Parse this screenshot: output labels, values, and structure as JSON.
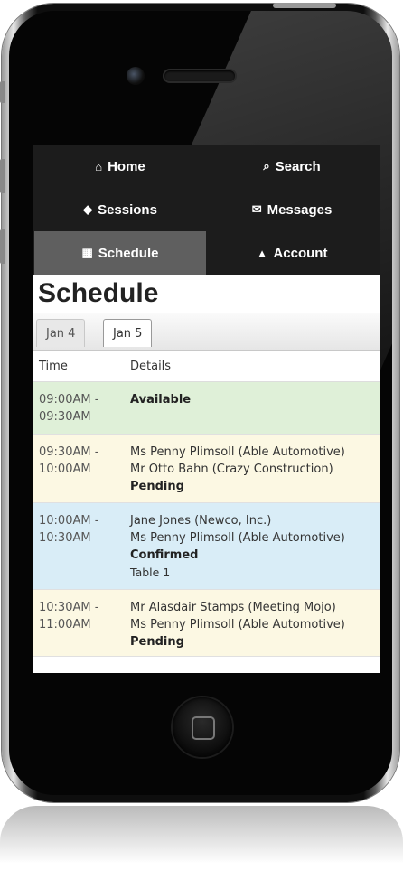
{
  "nav": {
    "items": [
      {
        "label": "Home",
        "icon": "home-icon",
        "glyph": "⌂"
      },
      {
        "label": "Search",
        "icon": "search-icon",
        "glyph": "⌕"
      },
      {
        "label": "Sessions",
        "icon": "tag-icon",
        "glyph": "◆"
      },
      {
        "label": "Messages",
        "icon": "envelope-icon",
        "glyph": "✉"
      },
      {
        "label": "Schedule",
        "icon": "calendar-icon",
        "glyph": "▦",
        "active": true
      },
      {
        "label": "Account",
        "icon": "user-icon",
        "glyph": "▲"
      }
    ]
  },
  "page": {
    "title": "Schedule"
  },
  "tabs": {
    "items": [
      {
        "label": "Jan 4",
        "active": false
      },
      {
        "label": "Jan 5",
        "active": true
      }
    ]
  },
  "table": {
    "headers": {
      "time": "Time",
      "details": "Details"
    },
    "rows": [
      {
        "time": "09:00AM - 09:30AM",
        "status": "Available",
        "color": "#dff0d8",
        "participants": []
      },
      {
        "time": "09:30AM - 10:00AM",
        "participants": [
          "Ms Penny Plimsoll (Able Automotive)",
          "Mr Otto Bahn (Crazy Construction)"
        ],
        "status": "Pending",
        "color": "#fcf8e3"
      },
      {
        "time": "10:00AM - 10:30AM",
        "participants": [
          "Jane Jones (Newco, Inc.)",
          "Ms Penny Plimsoll (Able Automotive)"
        ],
        "status": "Confirmed",
        "note": "Table 1",
        "color": "#d9edf7"
      },
      {
        "time": "10:30AM - 11:00AM",
        "participants": [
          "Mr Alasdair Stamps (Meeting Mojo)",
          "Ms Penny Plimsoll (Able Automotive)"
        ],
        "status": "Pending",
        "color": "#fcf8e3"
      }
    ]
  }
}
